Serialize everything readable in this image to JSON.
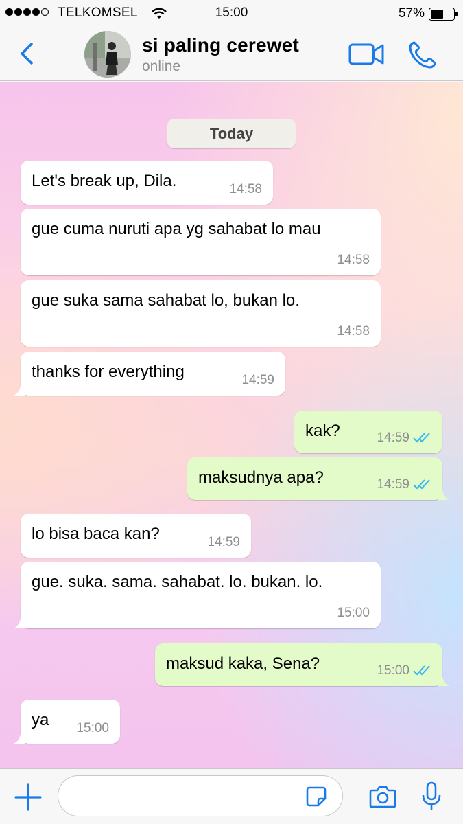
{
  "status_bar": {
    "carrier": "TELKOMSEL",
    "time": "15:00",
    "battery": "57%",
    "battery_level": 0.57,
    "signal_bars": 4
  },
  "header": {
    "contact_name": "si paling cerewet",
    "contact_status": "online",
    "back_icon": "chevron-left-icon",
    "video_icon": "video-camera-icon",
    "call_icon": "phone-icon"
  },
  "chat": {
    "date_chip": "Today",
    "messages": [
      {
        "dir": "in",
        "text": "Let's break up, Dila.",
        "time": "14:58"
      },
      {
        "dir": "in",
        "text": "gue cuma nuruti apa yg sahabat lo mau",
        "time": "14:58"
      },
      {
        "dir": "in",
        "text": "gue suka sama sahabat lo, bukan lo.",
        "time": "14:58"
      },
      {
        "dir": "in",
        "text": "thanks for everything",
        "time": "14:59"
      },
      {
        "dir": "out",
        "text": "kak?",
        "time": "14:59",
        "status": "read"
      },
      {
        "dir": "out",
        "text": "maksudnya apa?",
        "time": "14:59",
        "status": "read"
      },
      {
        "dir": "in",
        "text": "lo bisa baca kan?",
        "time": "14:59"
      },
      {
        "dir": "in",
        "text": "gue. suka. sama. sahabat. lo. bukan. lo.",
        "time": "15:00"
      },
      {
        "dir": "out",
        "text": "maksud kaka, Sena?",
        "time": "15:00",
        "status": "read"
      },
      {
        "dir": "in",
        "text": "ya",
        "time": "15:00"
      }
    ]
  },
  "input_bar": {
    "message_value": "",
    "icons": [
      "plus-icon",
      "sticker-icon",
      "camera-icon",
      "microphone-icon"
    ]
  },
  "colors": {
    "accent": "#1a7ae8",
    "incoming_bubble": "#ffffff",
    "outgoing_bubble": "#e2fbc9",
    "read_ticks": "#34b7f1"
  }
}
